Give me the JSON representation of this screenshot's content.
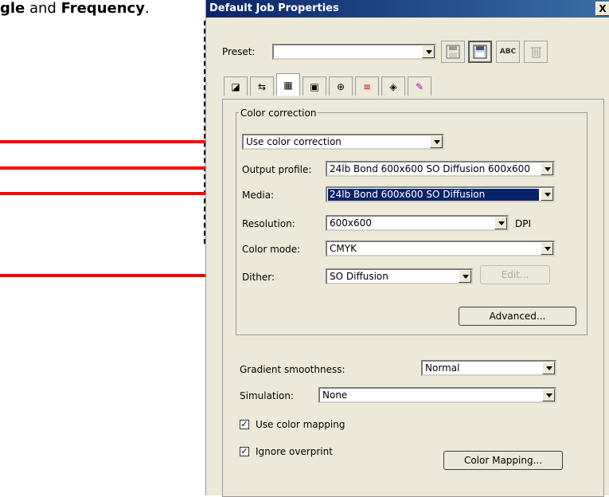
{
  "doc": {
    "text_bold1": "gle",
    "text_mid": " and ",
    "text_bold2": "Frequency",
    "text_end": "."
  },
  "dialog": {
    "title": "Default Job Properties",
    "close": "X",
    "preset_label": "Preset:",
    "preset_value": "",
    "toolbar": {
      "abc": "ABC"
    },
    "tabs_count": 8,
    "group_title": "Color correction",
    "color_correction": {
      "value": "Use color correction"
    },
    "output_profile": {
      "label": "Output profile:",
      "value": "24lb Bond 600x600 SO Diffusion 600x600"
    },
    "media": {
      "label": "Media:",
      "value": "24lb Bond 600x600 SO Diffusion"
    },
    "resolution": {
      "label": "Resolution:",
      "value": "600x600",
      "unit": "DPI"
    },
    "color_mode": {
      "label": "Color mode:",
      "value": "CMYK"
    },
    "dither": {
      "label": "Dither:",
      "value": "SO Diffusion",
      "edit": "Edit..."
    },
    "advanced": "Advanced...",
    "gradient": {
      "label": "Gradient smoothness:",
      "value": "Normal"
    },
    "simulation": {
      "label": "Simulation:",
      "value": "None"
    },
    "use_color_mapping": {
      "label": "Use color mapping",
      "checked": true
    },
    "ignore_overprint": {
      "label": "Ignore overprint",
      "checked": true
    },
    "color_mapping_btn": "Color Mapping..."
  },
  "colors": {
    "arrow": "#ff0000",
    "title_bar": "#0a246a",
    "dialog_bg": "#ece9d8"
  }
}
